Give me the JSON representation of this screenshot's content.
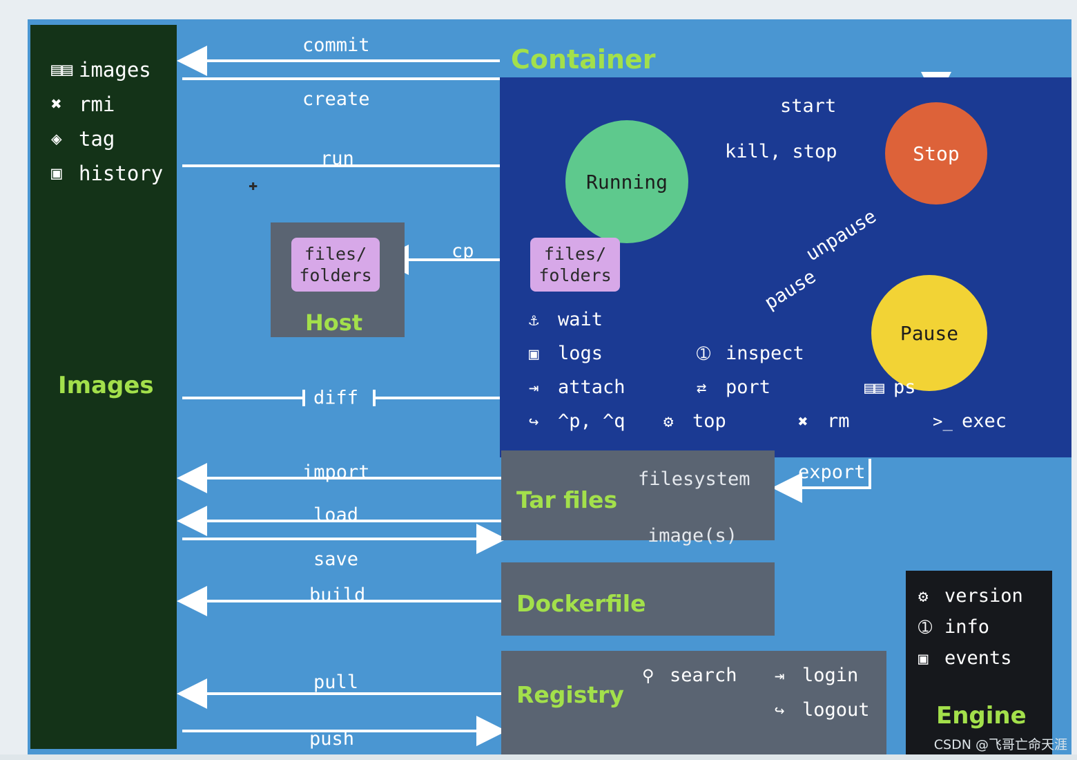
{
  "diagram": {
    "title_container": "Container",
    "title_images": "Images",
    "title_host": "Host",
    "title_tar": "Tar files",
    "title_dockerfile": "Dockerfile",
    "title_registry": "Registry",
    "title_engine": "Engine",
    "colors": {
      "background": "#4a96d2",
      "images_panel": "#143318",
      "container_panel": "#1b3a93",
      "box_gray": "#5a6472",
      "engine_panel": "#16181c",
      "accent_green_text": "#a3e04b",
      "running": "#5ec98d",
      "stop": "#dd6239",
      "pause": "#f2d335",
      "files_folders": "#d7a8e8"
    }
  },
  "images_commands": [
    {
      "icon": "list-icon",
      "glyph": "☰",
      "label": "images"
    },
    {
      "icon": "x-mark-icon",
      "glyph": "✖",
      "label": "rmi"
    },
    {
      "icon": "tag-icon",
      "glyph": "🏷",
      "label": "tag"
    },
    {
      "icon": "document-icon",
      "glyph": "὜b",
      "label": "history"
    }
  ],
  "states": [
    {
      "name": "Running"
    },
    {
      "name": "Stop"
    },
    {
      "name": "Pause"
    }
  ],
  "container_commands": [
    [
      {
        "icon": "anchor-icon",
        "glyph": "⚓",
        "label": "wait"
      },
      {
        "icon": "",
        "glyph": "",
        "label": ""
      },
      {
        "icon": "",
        "glyph": "",
        "label": ""
      }
    ],
    [
      {
        "icon": "document-icon",
        "glyph": "὜b",
        "label": "logs"
      },
      {
        "icon": "info-icon",
        "glyph": "ℹ",
        "label": "inspect"
      },
      {
        "icon": "",
        "glyph": "",
        "label": ""
      }
    ],
    [
      {
        "icon": "attach-arrow-icon",
        "glyph": "➡",
        "label": "attach"
      },
      {
        "icon": "port-swap-icon",
        "glyph": "⇄",
        "label": "port"
      },
      {
        "icon": "list-icon",
        "glyph": "☰",
        "label": "ps"
      }
    ],
    [
      {
        "icon": "exit-icon",
        "glyph": "↪",
        "label": "^p, ^q"
      },
      {
        "icon": "gears-icon",
        "glyph": "⚙",
        "label": "top"
      },
      {
        "icon": "x-mark-icon",
        "glyph": "✖",
        "label": "rm"
      },
      {
        "icon": "terminal-icon",
        "glyph": ">_",
        "label": "exec"
      }
    ]
  ],
  "files_folders": {
    "host_label": "files/\nfolders",
    "host_label_line1": "files/",
    "host_label_line2": "folders",
    "container_label_line1": "files/",
    "container_label_line2": "folders"
  },
  "tar": {
    "line1": "filesystem",
    "line2": "image(s)"
  },
  "registry_commands": [
    {
      "icon": "search-icon",
      "glyph": "⌕",
      "label": "search"
    },
    {
      "icon": "login-icon",
      "glyph": "➡",
      "label": "login"
    },
    {
      "icon": "logout-icon",
      "glyph": "↪",
      "label": "logout"
    }
  ],
  "engine_commands": [
    {
      "icon": "gear-icon",
      "glyph": "⚙",
      "label": "version"
    },
    {
      "icon": "info-icon",
      "glyph": "ℹ",
      "label": "info"
    },
    {
      "icon": "document-icon",
      "glyph": "὜b",
      "label": "events"
    }
  ],
  "edge_labels": {
    "commit": "commit",
    "create": "create",
    "run": "run",
    "diff": "diff",
    "cp": "cp",
    "start": "start",
    "kill_stop": "kill, stop",
    "unpause": "unpause",
    "pause": "pause",
    "import": "import",
    "load": "load",
    "save": "save",
    "build": "build",
    "pull": "pull",
    "push": "push",
    "export": "export"
  },
  "watermark": "CSDN @飞哥亡命天涯"
}
